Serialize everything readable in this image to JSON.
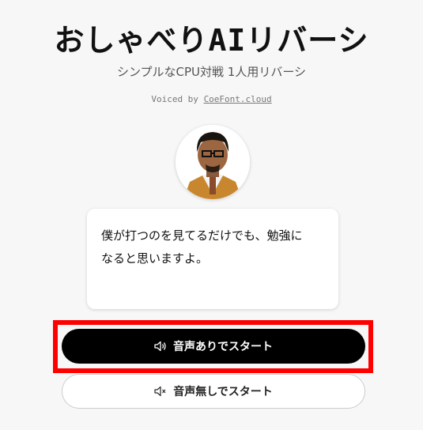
{
  "header": {
    "title": "おしゃべりAIリバーシ",
    "subtitle": "シンプルなCPU対戦 1人用リバーシ",
    "voiced_prefix": "Voiced by ",
    "voiced_link": "CoeFont.cloud"
  },
  "speech": {
    "line1": "僕が打つのを見てるだけでも、勉強に",
    "line2": "なると思いますよ。"
  },
  "buttons": {
    "start_with_voice": "音声ありでスタート",
    "start_without_voice": "音声無しでスタート"
  },
  "icons": {
    "voice": "speaker-icon",
    "mute": "speaker-muted-icon"
  },
  "colors": {
    "primary_button": "#000000",
    "highlight": "#ff0000"
  }
}
